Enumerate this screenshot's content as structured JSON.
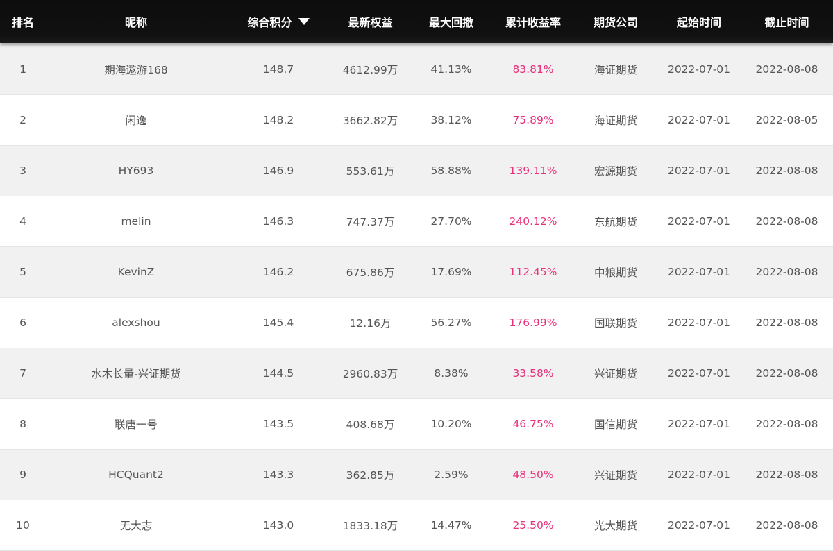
{
  "columns": {
    "rank": "排名",
    "nickname": "昵称",
    "score": "综合积分",
    "equity": "最新权益",
    "drawdown": "最大回撤",
    "return": "累计收益率",
    "firm": "期货公司",
    "start": "起始时间",
    "end": "截止时间"
  },
  "colors": {
    "header_bg": "#111111",
    "return_text": "#e8317a",
    "row_alt": "#f1f1f1"
  },
  "icons": {
    "sort": "caret-down-icon"
  },
  "rows": [
    {
      "rank": "1",
      "name": "期海遨游168",
      "score": "148.7",
      "equity": "4612.99万",
      "drawdown": "41.13%",
      "return": "83.81%",
      "firm": "海证期货",
      "start": "2022-07-01",
      "end": "2022-08-08"
    },
    {
      "rank": "2",
      "name": "闲逸",
      "score": "148.2",
      "equity": "3662.82万",
      "drawdown": "38.12%",
      "return": "75.89%",
      "firm": "海证期货",
      "start": "2022-07-01",
      "end": "2022-08-05"
    },
    {
      "rank": "3",
      "name": "HY693",
      "score": "146.9",
      "equity": "553.61万",
      "drawdown": "58.88%",
      "return": "139.11%",
      "firm": "宏源期货",
      "start": "2022-07-01",
      "end": "2022-08-08"
    },
    {
      "rank": "4",
      "name": "melin",
      "score": "146.3",
      "equity": "747.37万",
      "drawdown": "27.70%",
      "return": "240.12%",
      "firm": "东航期货",
      "start": "2022-07-01",
      "end": "2022-08-08"
    },
    {
      "rank": "5",
      "name": "KevinZ",
      "score": "146.2",
      "equity": "675.86万",
      "drawdown": "17.69%",
      "return": "112.45%",
      "firm": "中粮期货",
      "start": "2022-07-01",
      "end": "2022-08-08"
    },
    {
      "rank": "6",
      "name": "alexshou",
      "score": "145.4",
      "equity": "12.16万",
      "drawdown": "56.27%",
      "return": "176.99%",
      "firm": "国联期货",
      "start": "2022-07-01",
      "end": "2022-08-08"
    },
    {
      "rank": "7",
      "name": "水木长量-兴证期货",
      "score": "144.5",
      "equity": "2960.83万",
      "drawdown": "8.38%",
      "return": "33.58%",
      "firm": "兴证期货",
      "start": "2022-07-01",
      "end": "2022-08-08"
    },
    {
      "rank": "8",
      "name": "联唐一号",
      "score": "143.5",
      "equity": "408.68万",
      "drawdown": "10.20%",
      "return": "46.75%",
      "firm": "国信期货",
      "start": "2022-07-01",
      "end": "2022-08-08"
    },
    {
      "rank": "9",
      "name": "HCQuant2",
      "score": "143.3",
      "equity": "362.85万",
      "drawdown": "2.59%",
      "return": "48.50%",
      "firm": "兴证期货",
      "start": "2022-07-01",
      "end": "2022-08-08"
    },
    {
      "rank": "10",
      "name": "无大志",
      "score": "143.0",
      "equity": "1833.18万",
      "drawdown": "14.47%",
      "return": "25.50%",
      "firm": "光大期货",
      "start": "2022-07-01",
      "end": "2022-08-08"
    }
  ]
}
